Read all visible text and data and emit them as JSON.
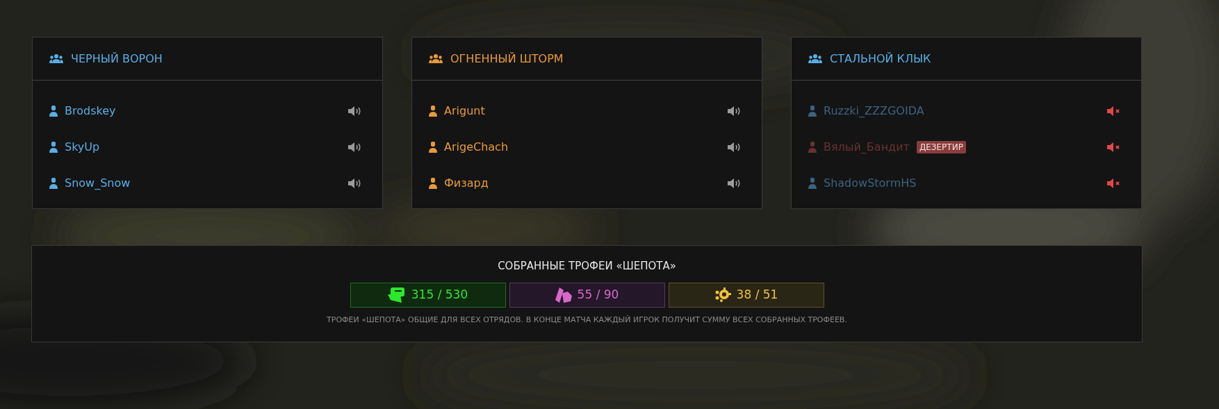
{
  "squads": [
    {
      "name": "ЧЕРНЫЙ ВОРОН",
      "color": "#5aaee6",
      "players": [
        {
          "name": "Brodskey",
          "color": "#5aaee6",
          "muted": false
        },
        {
          "name": "SkyUp",
          "color": "#5aaee6",
          "muted": false
        },
        {
          "name": "Snow_Snow",
          "color": "#5aaee6",
          "muted": false
        }
      ]
    },
    {
      "name": "ОГНЕННЫЙ ШТОРМ",
      "color": "#e89a3c",
      "players": [
        {
          "name": "Arigunt",
          "color": "#e89a3c",
          "muted": false
        },
        {
          "name": "ArigeChach",
          "color": "#e89a3c",
          "muted": false
        },
        {
          "name": "Физард",
          "color": "#e89a3c",
          "muted": false
        }
      ]
    },
    {
      "name": "СТАЛЬНОЙ КЛЫК",
      "color": "#5aaee6",
      "players": [
        {
          "name": "Ruzzki_ZZZGOIDA",
          "color": "#3c6282",
          "muted": true
        },
        {
          "name": "Вялый_Бандит",
          "color": "#6b3131",
          "muted": true,
          "badge": "ДЕЗЕРТИР"
        },
        {
          "name": "ShadowStormHS",
          "color": "#3c6282",
          "muted": true
        }
      ]
    }
  ],
  "trophies": {
    "title": "СОБРАННЫЕ ТРОФЕИ «ШЕПОТА»",
    "items": [
      {
        "kind": "crate",
        "value": "315 / 530",
        "color": "#2ee62e"
      },
      {
        "kind": "tag",
        "value": "55 / 90",
        "color": "#d868c8"
      },
      {
        "kind": "gear",
        "value": "38 / 51",
        "color": "#f0c040"
      }
    ],
    "note": "ТРОФЕИ «ШЕПОТА» ОБЩИЕ ДЛЯ ВСЕХ ОТРЯДОВ. В КОНЦЕ МАТЧА КАЖДЫЙ ИГРОК ПОЛУЧИТ СУММУ ВСЕХ СОБРАННЫХ ТРОФЕЕВ."
  }
}
